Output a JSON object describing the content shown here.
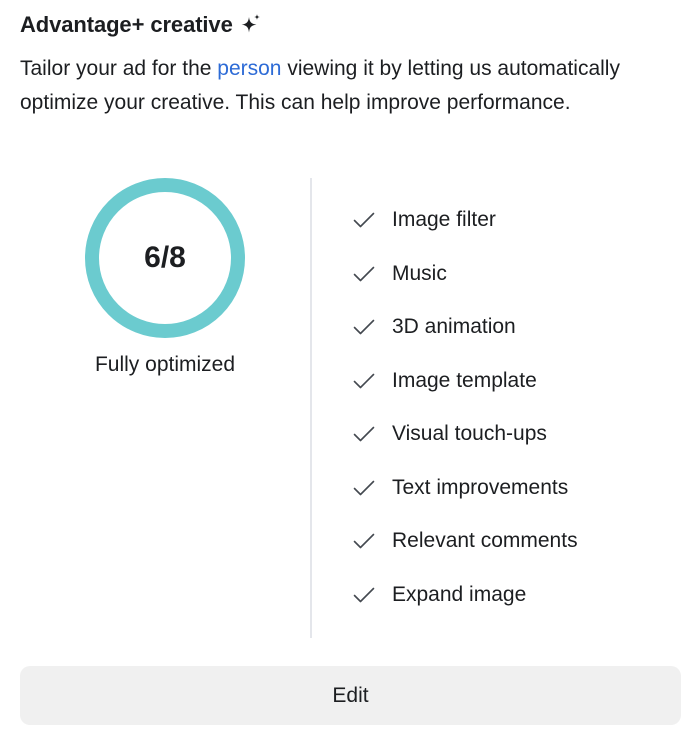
{
  "header": {
    "title": "Advantage+ creative",
    "title_icon": "sparkle-icon"
  },
  "description": {
    "before_link": "Tailor your ad for the ",
    "link_text": "person",
    "after_link": " viewing it by letting us automatically optimize your creative. This can help improve performance."
  },
  "score": {
    "enabled": 6,
    "total": 8,
    "label": "6/8",
    "caption": "Fully optimized",
    "ring_color": "#6bcbcf"
  },
  "features": [
    {
      "label": "Image filter",
      "icon": "checkmark-icon"
    },
    {
      "label": "Music",
      "icon": "checkmark-icon"
    },
    {
      "label": "3D animation",
      "icon": "checkmark-icon"
    },
    {
      "label": "Image template",
      "icon": "checkmark-icon"
    },
    {
      "label": "Visual touch-ups",
      "icon": "checkmark-icon"
    },
    {
      "label": "Text improvements",
      "icon": "checkmark-icon"
    },
    {
      "label": "Relevant comments",
      "icon": "checkmark-icon"
    },
    {
      "label": "Expand image",
      "icon": "checkmark-icon"
    }
  ],
  "actions": {
    "edit_label": "Edit"
  },
  "colors": {
    "link": "#2d6bd6",
    "text": "#1c1e21",
    "button_bg": "#f0f0f0"
  }
}
